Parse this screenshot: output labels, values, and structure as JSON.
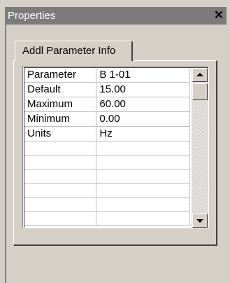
{
  "window": {
    "title": "Properties",
    "close_glyph": "✕"
  },
  "tabs": [
    {
      "label": "Addl Parameter Info",
      "active": true
    }
  ],
  "grid": {
    "rows": [
      {
        "name": "Parameter",
        "value": "B 1-01"
      },
      {
        "name": "Default",
        "value": "15.00"
      },
      {
        "name": "Maximum",
        "value": "60.00"
      },
      {
        "name": "Minimum",
        "value": "0.00"
      },
      {
        "name": "Units",
        "value": "Hz"
      },
      {
        "name": "",
        "value": ""
      },
      {
        "name": "",
        "value": ""
      },
      {
        "name": "",
        "value": ""
      },
      {
        "name": "",
        "value": ""
      },
      {
        "name": "",
        "value": ""
      },
      {
        "name": "",
        "value": ""
      }
    ]
  },
  "scrollbar": {
    "up_icon": "scroll-up-arrow-icon",
    "down_icon": "scroll-down-arrow-icon",
    "position": 0.0
  },
  "colors": {
    "face": "#d4d0c8",
    "titlebar_inactive": "#7b7b7b",
    "grid_bg": "#ffffff",
    "grid_lines": "#c0c0c0"
  }
}
